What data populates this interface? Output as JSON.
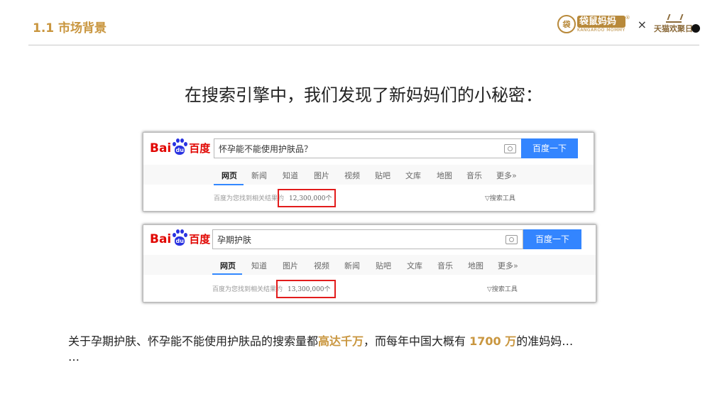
{
  "header": {
    "section_title": "1.1  市场背景",
    "brand_kangaroo_cn": "袋鼠妈妈",
    "brand_kangaroo_en": "KANGAROO MOMMY",
    "brand_reg": "®",
    "brand_times": "×",
    "brand_tmall": "天猫欢聚日"
  },
  "headline": "在搜索引擎中，我们发现了新妈妈们的小秘密：",
  "search_shots": [
    {
      "logo_left": "Bai",
      "logo_paw": "du",
      "logo_cn": "百度",
      "query": "怀孕能不能使用护肤品？",
      "button": "百度一下",
      "tabs": [
        "网页",
        "新闻",
        "知道",
        "图片",
        "视频",
        "贴吧",
        "文库",
        "地图",
        "音乐",
        "更多»"
      ],
      "active_tab": "网页",
      "result_prefix": "百度为您找到相关结果约",
      "result_count": "12,300,000个",
      "tools": "搜索工具"
    },
    {
      "logo_left": "Bai",
      "logo_paw": "du",
      "logo_cn": "百度",
      "query": "孕期护肤",
      "button": "百度一下",
      "tabs": [
        "网页",
        "知道",
        "图片",
        "视频",
        "新闻",
        "贴吧",
        "文库",
        "音乐",
        "地图",
        "更多»"
      ],
      "active_tab": "网页",
      "result_prefix": "百度为您找到相关结果约",
      "result_count": "13,300,000个",
      "tools": "搜索工具"
    }
  ],
  "summary": {
    "part1": "关于孕期护肤、怀孕能不能使用护肤品的搜索量都",
    "highlight1": "高达千万",
    "part2": "，而每年中国大概有 ",
    "highlight2": "1700 万",
    "part3": "的准妈妈…",
    "part4": "…"
  },
  "colors": {
    "accent": "#c9963f",
    "baidu_red": "#e10602",
    "baidu_blue": "#2932e1",
    "button_blue": "#3385ff",
    "highlight_box": "#e21c1c"
  }
}
